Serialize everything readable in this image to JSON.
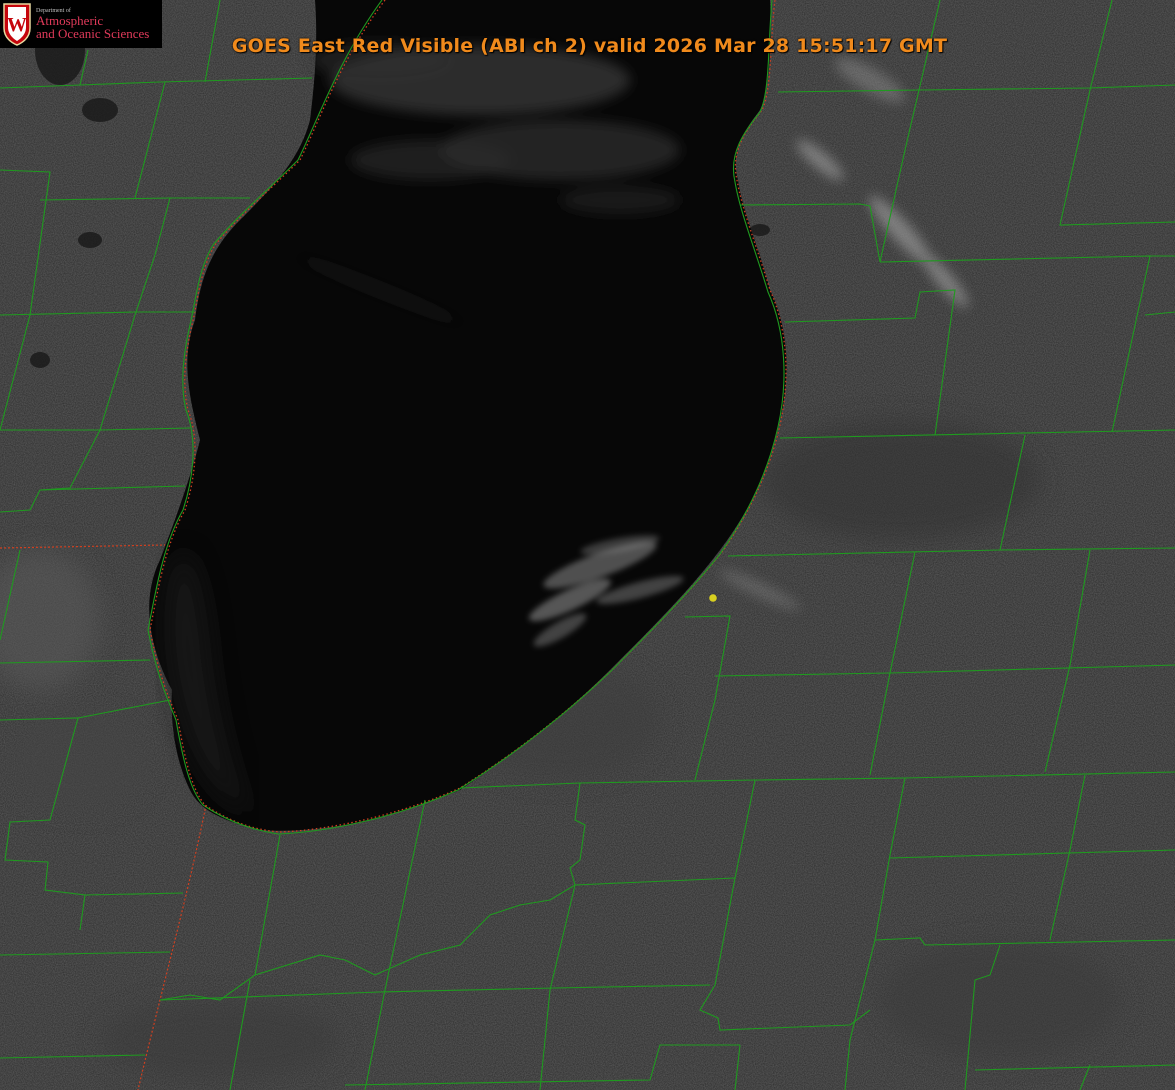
{
  "title": "GOES East Red Visible (ABI ch 2) valid 2026 Mar 28 15:51:17 GMT",
  "logo": {
    "dept": "Department of",
    "line1": "Atmospheric",
    "line2": "and Oceanic Sciences",
    "emblem_letter": "W"
  },
  "colors": {
    "county_lines": "#1f9a1f",
    "state_lines": "#d04020",
    "title": "#f08a1c",
    "marker": "#d8d020",
    "lake": "#060606",
    "land": "#2a2a2a"
  },
  "map": {
    "region": "Lake Michigan (southern basin)",
    "marker": "observation-point"
  }
}
